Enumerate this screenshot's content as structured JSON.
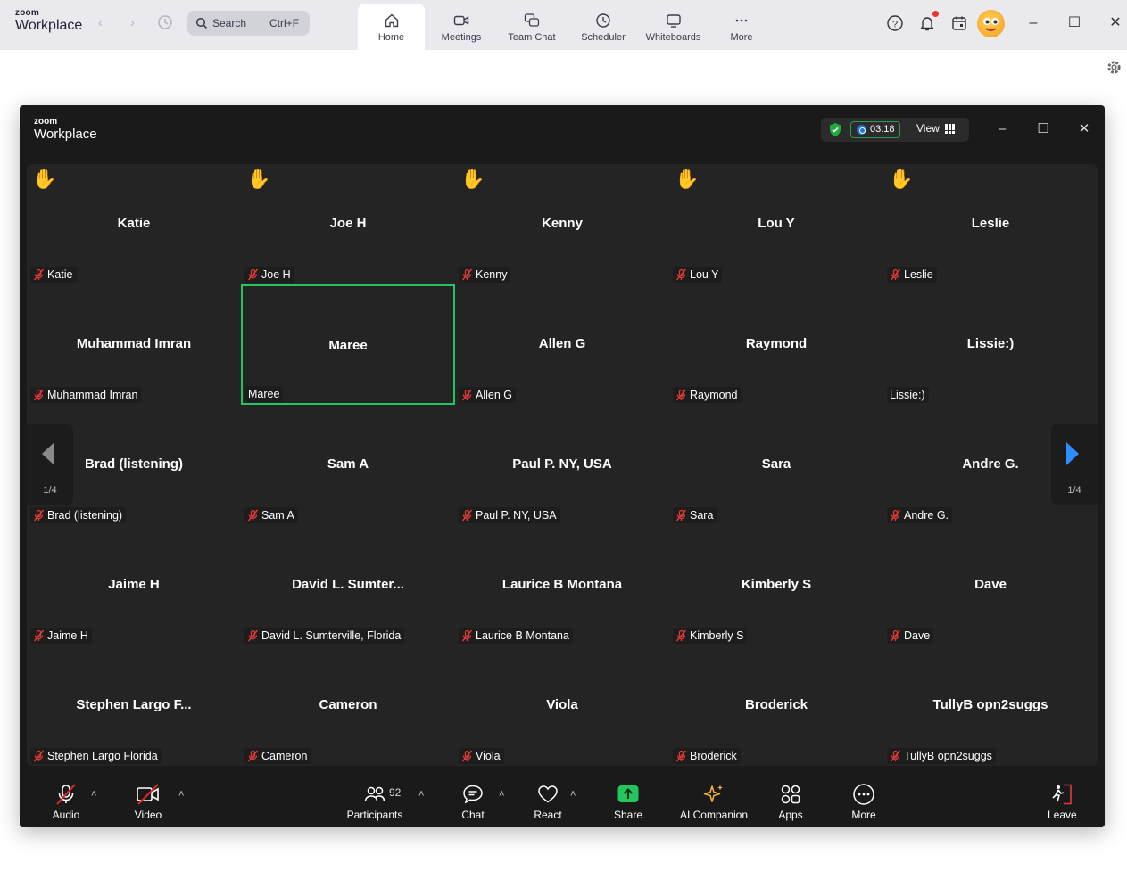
{
  "app": {
    "logo_small": "zoom",
    "logo_big": "Workplace"
  },
  "search": {
    "label": "Search",
    "shortcut": "Ctrl+F"
  },
  "tabs": [
    {
      "label": "Home",
      "icon": "home-icon",
      "active": true
    },
    {
      "label": "Meetings",
      "icon": "meetings-camera-icon"
    },
    {
      "label": "Team Chat",
      "icon": "team-chat-icon"
    },
    {
      "label": "Scheduler",
      "icon": "clock-icon"
    },
    {
      "label": "Whiteboards",
      "icon": "whiteboard-icon"
    },
    {
      "label": "More",
      "icon": "more-dots-icon"
    }
  ],
  "meeting": {
    "logo_small": "zoom",
    "logo_big": "Workplace",
    "timer": "03:18",
    "view_label": "View",
    "page_indicator_left": "1/4",
    "page_indicator_right": "1/4",
    "active_speaker_color": "#22c55e",
    "participants": [
      {
        "name": "Katie",
        "tag": "Katie",
        "muted": true,
        "hand": true
      },
      {
        "name": "Joe H",
        "tag": "Joe H",
        "muted": true,
        "hand": true
      },
      {
        "name": "Kenny",
        "tag": "Kenny",
        "muted": true,
        "hand": true
      },
      {
        "name": "Lou Y",
        "tag": "Lou Y",
        "muted": true,
        "hand": true
      },
      {
        "name": "Leslie",
        "tag": "Leslie",
        "muted": true,
        "hand": true
      },
      {
        "name": "Muhammad Imran",
        "tag": "Muhammad Imran",
        "muted": true,
        "hand": false
      },
      {
        "name": "Maree",
        "tag": "Maree",
        "muted": false,
        "hand": false,
        "active": true
      },
      {
        "name": "Allen G",
        "tag": "Allen G",
        "muted": true,
        "hand": false
      },
      {
        "name": "Raymond",
        "tag": "Raymond",
        "muted": true,
        "hand": false
      },
      {
        "name": "Lissie:)",
        "tag": "Lissie:)",
        "muted": false,
        "hand": false
      },
      {
        "name": "Brad (listening)",
        "tag": "Brad (listening)",
        "muted": true,
        "hand": false
      },
      {
        "name": "Sam A",
        "tag": "Sam A",
        "muted": true,
        "hand": false
      },
      {
        "name": "Paul P. NY, USA",
        "tag": "Paul P. NY, USA",
        "muted": true,
        "hand": false
      },
      {
        "name": "Sara",
        "tag": "Sara",
        "muted": true,
        "hand": false
      },
      {
        "name": "Andre G.",
        "tag": "Andre G.",
        "muted": true,
        "hand": false
      },
      {
        "name": "Jaime H",
        "tag": "Jaime H",
        "muted": true,
        "hand": false
      },
      {
        "name": "David L.  Sumter...",
        "tag": "David L.  Sumterville, Florida",
        "muted": true,
        "hand": false
      },
      {
        "name": "Laurice B Montana",
        "tag": "Laurice B Montana",
        "muted": true,
        "hand": false
      },
      {
        "name": "Kimberly S",
        "tag": "Kimberly S",
        "muted": true,
        "hand": false
      },
      {
        "name": "Dave",
        "tag": "Dave",
        "muted": true,
        "hand": false
      },
      {
        "name": "Stephen  Largo F...",
        "tag": "Stephen  Largo Florida",
        "muted": true,
        "hand": false
      },
      {
        "name": "Cameron",
        "tag": "Cameron",
        "muted": true,
        "hand": false
      },
      {
        "name": "Viola",
        "tag": "Viola",
        "muted": true,
        "hand": false
      },
      {
        "name": "Broderick",
        "tag": "Broderick",
        "muted": true,
        "hand": false
      },
      {
        "name": "TullyB opn2suggs",
        "tag": "TullyB opn2suggs",
        "muted": true,
        "hand": false
      }
    ]
  },
  "toolbar": {
    "audio": "Audio",
    "video": "Video",
    "participants": "Participants",
    "participants_count": "92",
    "chat": "Chat",
    "react": "React",
    "share": "Share",
    "ai_companion": "AI Companion",
    "apps": "Apps",
    "more": "More",
    "leave": "Leave"
  }
}
